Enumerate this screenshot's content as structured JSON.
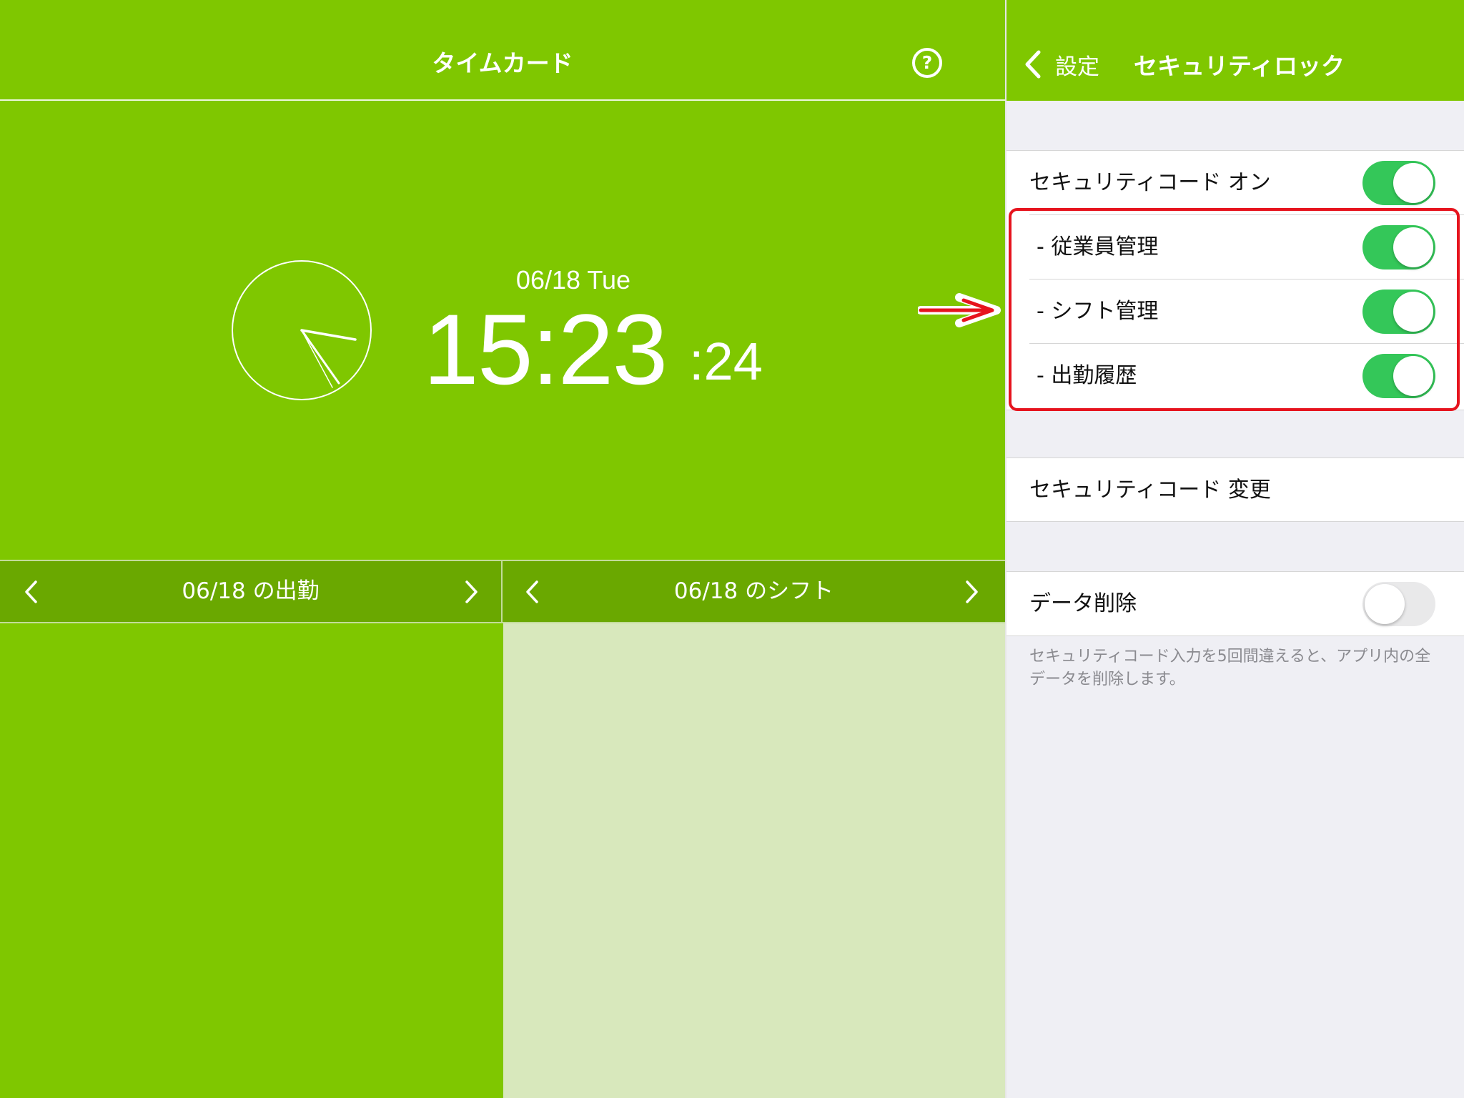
{
  "timecard": {
    "title": "タイムカード",
    "help_symbol": "?",
    "date": "06/18 Tue",
    "time": "15:23",
    "seconds": ":24",
    "attendance_label": "06/18 の出勤",
    "shift_label": "06/18 のシフト"
  },
  "settings": {
    "back_label": "設定",
    "title": "セキュリティロック",
    "security_code_on": {
      "label": "セキュリティコード オン",
      "value": true
    },
    "sub_items": [
      {
        "label": "- 従業員管理",
        "value": true
      },
      {
        "label": "- シフト管理",
        "value": true
      },
      {
        "label": "- 出勤履歴",
        "value": true
      }
    ],
    "change_code_label": "セキュリティコード 変更",
    "delete_data": {
      "label": "データ削除",
      "value": false
    },
    "footnote": "セキュリティコード入力を5回間違えると、アプリ内の全データを削除します。"
  },
  "colors": {
    "brand_green": "#7fc700",
    "bar_green": "#6aa800",
    "toggle_on": "#34c759",
    "highlight_red": "#e6141e"
  }
}
